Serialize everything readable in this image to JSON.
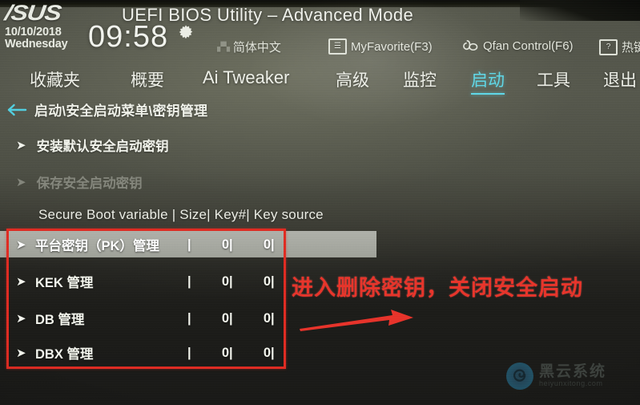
{
  "header": {
    "brand": "/SUS",
    "title": "UEFI BIOS Utility – Advanced Mode",
    "date": "10/10/2018",
    "weekday": "Wednesday",
    "time": "09:58",
    "gear_icon": "gear-icon",
    "language": "简体中文",
    "language_icon": "language-icon",
    "my_favorite": "MyFavorite(F3)",
    "my_favorite_icon": "notes-icon",
    "qfan": "Qfan Control(F6)",
    "qfan_icon": "fan-icon",
    "hotkey": "热键",
    "hotkey_icon": "question-mark-icon"
  },
  "tabs": [
    {
      "label": "收藏夹",
      "active": false
    },
    {
      "label": "概要",
      "active": false
    },
    {
      "label": "Ai Tweaker",
      "active": false
    },
    {
      "label": "高级",
      "active": false
    },
    {
      "label": "监控",
      "active": false
    },
    {
      "label": "启动",
      "active": true
    },
    {
      "label": "工具",
      "active": false
    },
    {
      "label": "退出",
      "active": false
    }
  ],
  "breadcrumb": {
    "back_icon": "back-arrow-icon",
    "path": "启动\\安全启动菜单\\密钥管理"
  },
  "menu_items": [
    {
      "label": "安装默认安全启动密钥",
      "disabled": false,
      "arrow": "➤"
    },
    {
      "label": "保存安全启动密钥",
      "disabled": true,
      "arrow": "➤"
    }
  ],
  "table": {
    "header": "Secure Boot variable  |  Size| Key#| Key source",
    "columns": [
      "Secure Boot variable",
      "Size",
      "Key#",
      "Key source"
    ],
    "rows": [
      {
        "arrow": "➤",
        "name": "平台密钥（PK）管理",
        "sep": "|",
        "size": "0|",
        "keynum": "0|",
        "selected": true
      },
      {
        "arrow": "➤",
        "name": "KEK 管理",
        "sep": "|",
        "size": "0|",
        "keynum": "0|",
        "selected": false
      },
      {
        "arrow": "➤",
        "name": "DB 管理",
        "sep": "|",
        "size": "0|",
        "keynum": "0|",
        "selected": false
      },
      {
        "arrow": "➤",
        "name": "DBX 管理",
        "sep": "|",
        "size": "0|",
        "keynum": "0|",
        "selected": false
      }
    ]
  },
  "annotation": {
    "text": "进入删除密钥，关闭安全启动",
    "arrow_icon": "red-arrow-right-icon",
    "box_color": "#e02b22",
    "text_color": "#e8342a"
  },
  "watermark": {
    "name": "黑云系统",
    "url": "heiyunxitong.com",
    "logo_icon": "spiral-logo-icon"
  },
  "colors": {
    "accent_cyan": "#5fd8e8",
    "annotation_red": "#e02b22",
    "panel_bg": "#4e5046",
    "panel_bg_dark": "#1a1a17"
  }
}
